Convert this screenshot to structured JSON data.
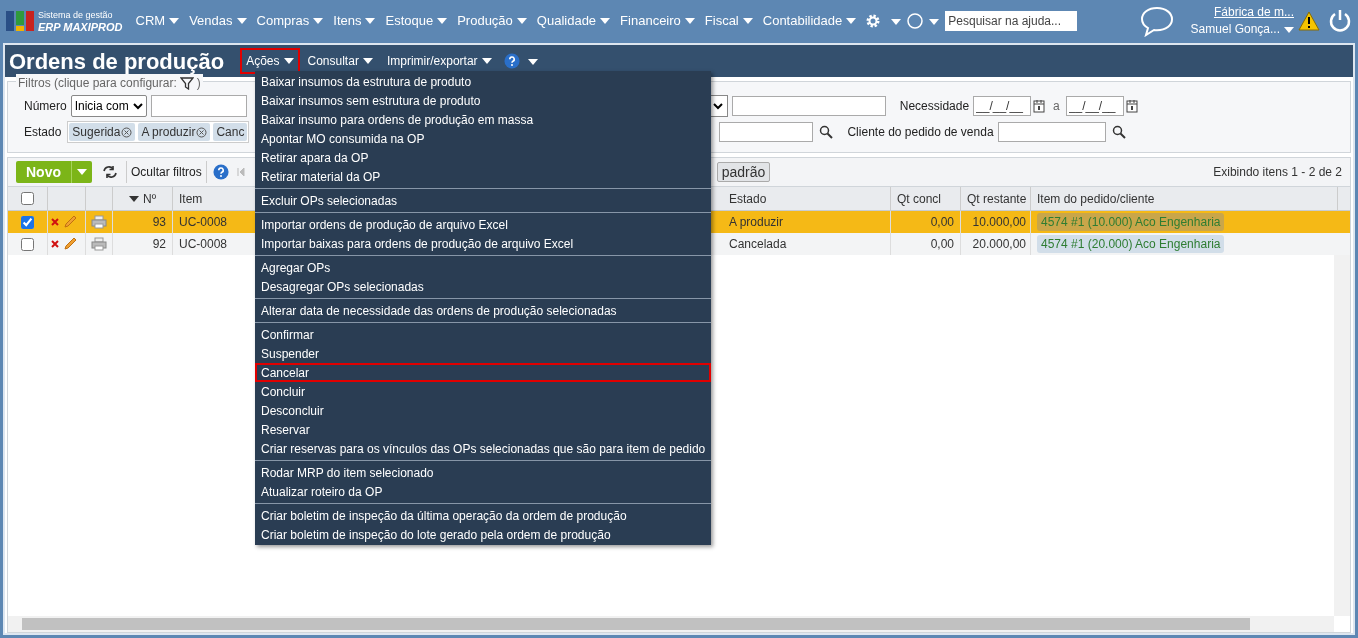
{
  "brand": {
    "line1": "Sistema de gestão",
    "line2": "ERP MAXIPROD"
  },
  "nav": [
    "CRM",
    "Vendas",
    "Compras",
    "Itens",
    "Estoque",
    "Produção",
    "Qualidade",
    "Financeiro",
    "Fiscal",
    "Contabilidade"
  ],
  "help_search": {
    "placeholder": "Pesquisar na ajuda..."
  },
  "user": {
    "company": "Fábrica de m...",
    "name": "Samuel Gonça..."
  },
  "page_title": "Ordens de produção",
  "header_menus": [
    {
      "label": "Ações",
      "selected": true
    },
    {
      "label": "Consultar",
      "selected": false
    },
    {
      "label": "Imprimir/exportar",
      "selected": false
    }
  ],
  "actions_menu": [
    [
      {
        "label": "Baixar insumos da estrutura de produto",
        "selected": false
      },
      {
        "label": "Baixar insumos sem estrutura de produto",
        "selected": false
      },
      {
        "label": "Baixar insumo para ordens de produção em massa",
        "selected": false
      },
      {
        "label": "Apontar MO consumida na OP",
        "selected": false
      },
      {
        "label": "Retirar apara da OP",
        "selected": false
      },
      {
        "label": "Retirar material da OP",
        "selected": false
      }
    ],
    [
      {
        "label": "Excluir OPs selecionadas",
        "selected": false
      }
    ],
    [
      {
        "label": "Importar ordens de produção de arquivo Excel",
        "selected": false
      },
      {
        "label": "Importar baixas para ordens de produção de arquivo Excel",
        "selected": false
      }
    ],
    [
      {
        "label": "Agregar OPs",
        "selected": false
      },
      {
        "label": "Desagregar OPs selecionadas",
        "selected": false
      }
    ],
    [
      {
        "label": "Alterar data de necessidade das ordens de produção selecionadas",
        "selected": false
      }
    ],
    [
      {
        "label": "Confirmar",
        "selected": false
      },
      {
        "label": "Suspender",
        "selected": false
      },
      {
        "label": "Cancelar",
        "selected": true
      },
      {
        "label": "Concluir",
        "selected": false
      },
      {
        "label": "Desconcluir",
        "selected": false
      },
      {
        "label": "Reservar",
        "selected": false
      },
      {
        "label": "Criar reservas para os vínculos das OPs selecionadas que são para item de pedido",
        "selected": false
      }
    ],
    [
      {
        "label": "Rodar MRP do item selecionado",
        "selected": false
      },
      {
        "label": "Atualizar roteiro da OP",
        "selected": false
      }
    ],
    [
      {
        "label": "Criar boletim de inspeção da última operação da ordem de produção",
        "selected": false
      },
      {
        "label": "Criar boletim de inspeção do lote gerado pela ordem de produção",
        "selected": false
      }
    ]
  ],
  "filters": {
    "legend": "Filtros (clique para configurar:",
    "legend_end": ")",
    "numero_label": "Número",
    "numero_mode": "Inicia com",
    "necessidade_label": "Necessidade",
    "date_placeholder": "__/__/__",
    "date_sep": "a",
    "estado_label": "Estado",
    "estado_chips": [
      "Sugerida",
      "A produzir",
      "Canc"
    ],
    "cliente_label": "Cliente do pedido de venda"
  },
  "toolbar": {
    "new_button": "Novo",
    "hide_filters": "Ocultar filtros",
    "default_button": "padrão",
    "count": "Exibindo itens 1 - 2 de 2"
  },
  "table": {
    "all_selected": false,
    "columns": [
      "Nº",
      "Item",
      "Estado",
      "Qt concl",
      "Qt restante",
      "Item do pedido/cliente"
    ],
    "rows": [
      {
        "selected": true,
        "number": "93",
        "item": "UC-0008",
        "estado": "A produzir",
        "qt_concl": "0,00",
        "qt_restante": "10.000,00",
        "pedido": "4574 #1 (10.000) Aco Engenharia"
      },
      {
        "selected": false,
        "number": "92",
        "item": "UC-0008",
        "estado": "Cancelada",
        "qt_concl": "0,00",
        "qt_restante": "20.000,00",
        "pedido": "4574 #1 (20.000) Aco Engenharia"
      }
    ]
  }
}
